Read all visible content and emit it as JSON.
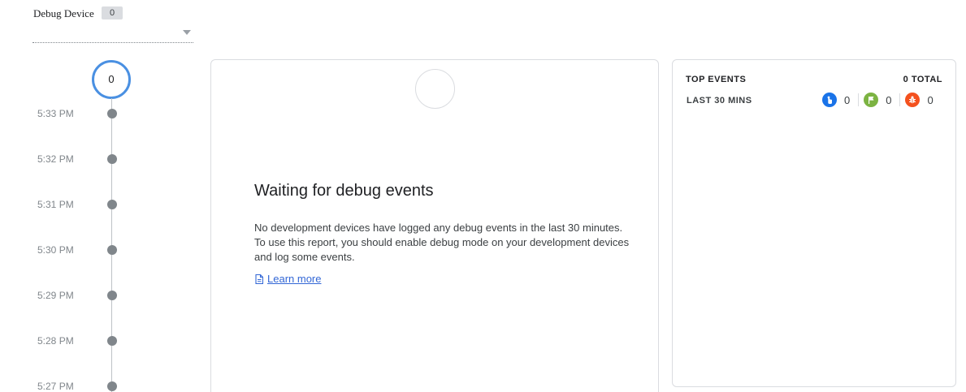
{
  "device_selector": {
    "label": "Debug Device",
    "count": "0"
  },
  "timeline": {
    "counter": "0",
    "times": [
      "5:33 PM",
      "5:32 PM",
      "5:31 PM",
      "5:30 PM",
      "5:29 PM",
      "5:28 PM",
      "5:27 PM"
    ],
    "accent_color": "#4a90e2"
  },
  "main": {
    "title": "Waiting for debug events",
    "description": "No development devices have logged any debug events in the last 30 minutes. To use this report, you should enable debug mode on your development devices and log some events.",
    "learn_more": "Learn more",
    "learn_more_icon": "document-icon"
  },
  "top_events": {
    "title": "TOP EVENTS",
    "total": "0 TOTAL",
    "period": "LAST 30 MINS",
    "categories": [
      {
        "icon": "touch-icon",
        "color": "#1a73e8",
        "count": "0"
      },
      {
        "icon": "flag-icon",
        "color": "#7cb342",
        "count": "0"
      },
      {
        "icon": "bug-icon",
        "color": "#f4511e",
        "count": "0"
      }
    ]
  }
}
